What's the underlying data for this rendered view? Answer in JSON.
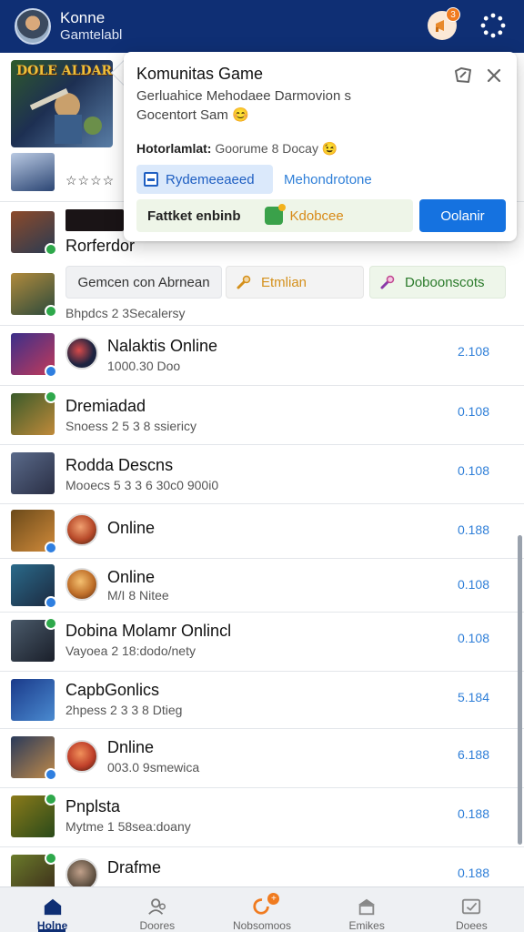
{
  "header": {
    "title": "Konne",
    "subtitle": "Gamtelabl",
    "notification_count": "3"
  },
  "featured": {
    "logo_text": "DOLE ALDAR",
    "stars": "☆☆☆☆"
  },
  "row2": {
    "title": "Rorferdor",
    "subtitle": "Bhpdcs 2 3Secalersy",
    "chips": [
      {
        "label": "Gemcen con Abrnean"
      },
      {
        "label": "Etmlian"
      },
      {
        "label": "Doboonscots"
      }
    ]
  },
  "rows": [
    {
      "title": "Nalaktis Online",
      "subtitle": "1000.30 Doo",
      "value": "2.108"
    },
    {
      "title": "Dremiadad",
      "subtitle": "Snoess 2 5 3 8 ssiericy",
      "value": "0.108"
    },
    {
      "title": "Rodda Descns",
      "subtitle": "Mooecs 5 3 3 6 30c0 900i0",
      "value": "0.108"
    },
    {
      "title": "Online",
      "subtitle": "",
      "value": "0.188"
    },
    {
      "title": "Online",
      "subtitle": "M/I 8 Nitee",
      "value": "0.108"
    },
    {
      "title": "Dobina Molamr Onlincl",
      "subtitle": "Vayoea 2 18:dodo/nety",
      "value": "0.108"
    },
    {
      "title": "CapbGonlics",
      "subtitle": "2hpess 2 3 3 8 Dtieg",
      "value": "5.184"
    },
    {
      "title": "Dnline",
      "subtitle": "003.0 9smewica",
      "value": "6.188"
    },
    {
      "title": "Pnplsta",
      "subtitle": "Mytme 1 58sea:doany",
      "value": "0.188"
    },
    {
      "title": "Drafme",
      "subtitle": "",
      "value": "0.188"
    }
  ],
  "popup": {
    "title": "Komunitas Game",
    "description": "Gerluahice Mehodaee Darmovion s Gocentort Sam 😊",
    "meta_label": "Hotorlamlat:",
    "meta_value": "Goorume 8 Docay 😉",
    "tag_label": "Rydemeeaeed",
    "link_label": "Mehondrotone",
    "bottom_label": "Fattket enbinb",
    "bottom_accent": "Kdobcee",
    "primary_button": "Oolanir"
  },
  "nav": {
    "items": [
      {
        "label": "Holne"
      },
      {
        "label": "Doores"
      },
      {
        "label": "Nobsomoos"
      },
      {
        "label": "Emikes"
      },
      {
        "label": "Doees"
      }
    ]
  },
  "colors": {
    "header_bg": "#0f2f74",
    "accent_blue": "#1572e0",
    "value_blue": "#2f7fd8",
    "badge_orange": "#f07b1f",
    "check_green": "#2ea84b"
  }
}
